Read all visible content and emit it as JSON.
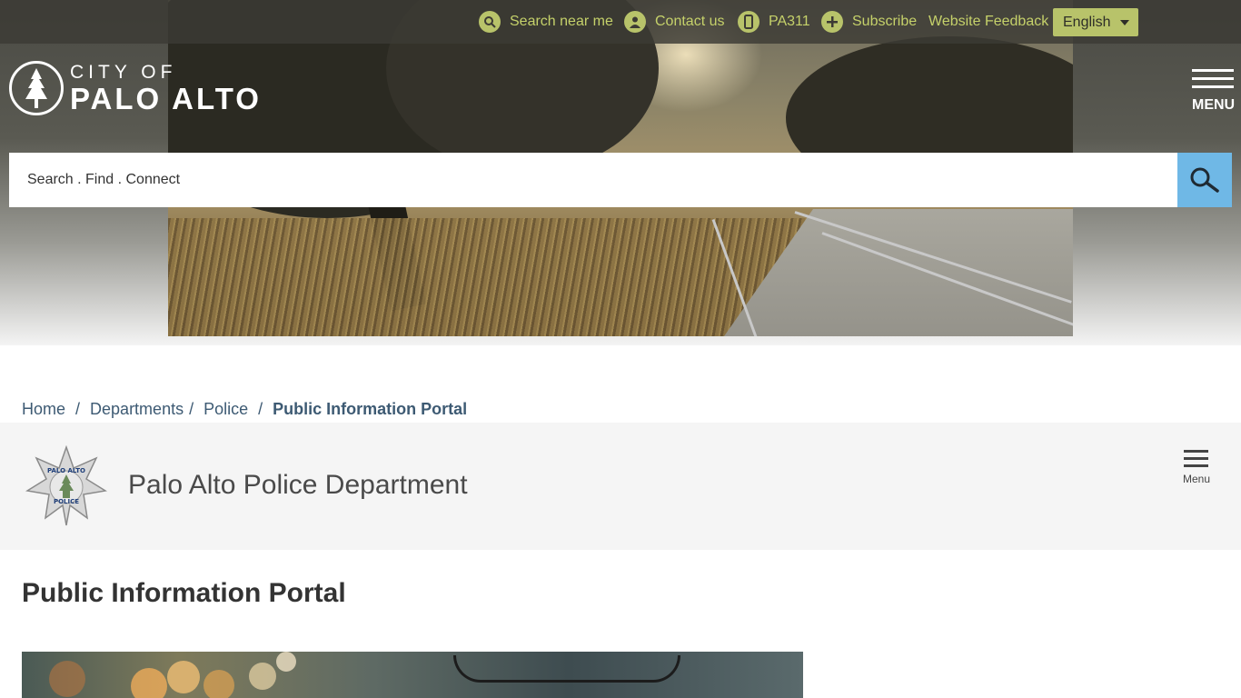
{
  "utility_bar": {
    "links": [
      {
        "label": "Search near me",
        "icon": "magnifier-icon"
      },
      {
        "label": "Contact us",
        "icon": "person-icon"
      },
      {
        "label": "PA311",
        "icon": "phone-icon"
      },
      {
        "label": "Subscribe",
        "icon": "plus-icon"
      },
      {
        "label": "Website Feedback",
        "icon": ""
      }
    ],
    "language": "English"
  },
  "logo": {
    "line1": "CITY OF",
    "line2": "PALO ALTO"
  },
  "main_menu": {
    "label": "MENU"
  },
  "search": {
    "placeholder": "Search . Find . Connect"
  },
  "breadcrumb": {
    "items": [
      "Home",
      "Departments",
      "Police"
    ],
    "current": "Public Information Portal",
    "separator": "/"
  },
  "department": {
    "title": "Palo Alto Police Department",
    "badge_top": "PALO ALTO",
    "badge_bottom": "POLICE",
    "menu_label": "Menu"
  },
  "page": {
    "title": "Public Information Portal"
  },
  "colors": {
    "utility_link": "#c5d16a",
    "accent_green": "#b8c36a",
    "search_button": "#6fb8e6",
    "breadcrumb": "#3d5a73"
  }
}
